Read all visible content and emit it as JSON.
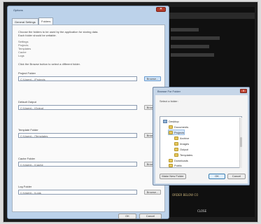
{
  "dark_app": {
    "status_1": "ORDER BELOW CO",
    "status_2": "CLOSE"
  },
  "main_dialog": {
    "title": "Options",
    "close_glyph": "✕",
    "tabs": [
      {
        "label": "General Settings"
      },
      {
        "label": "Folders"
      }
    ],
    "description": [
      "Choose the folders to be used by the application for storing data.",
      "Each folder should be writable."
    ],
    "list_items": [
      "Settings",
      "Projects",
      "Templates",
      "Cache",
      "Logs"
    ],
    "instruction": "Click the Browse button to select a different folder.",
    "fields": [
      {
        "label": "Project Folder",
        "value": "C:\\Users\\...\\Projects",
        "button": "Browse..."
      },
      {
        "label": "Default Output",
        "value": "C:\\Users\\...\\Output",
        "button": "Browse..."
      },
      {
        "label": "Template Folder",
        "value": "C:\\Users\\...\\Templates",
        "button": "Browse..."
      },
      {
        "label": "Cache Folder",
        "value": "C:\\Users\\...\\Cache",
        "button": "Browse..."
      },
      {
        "label": "Log Folder",
        "value": "C:\\Users\\...\\Logs",
        "button": "Browse..."
      }
    ],
    "ok_label": "OK",
    "cancel_label": "Cancel"
  },
  "folder_dialog": {
    "title": "Browse For Folder",
    "close_glyph": "✕",
    "prompt": "Select a folder:",
    "tree": [
      {
        "label": "Desktop",
        "icon": "pc-icon"
      },
      {
        "label": "Documents",
        "icon": "folder-icon"
      },
      {
        "label": "Projects",
        "icon": "folder-icon"
      },
      {
        "label": "Archive",
        "icon": "folder-icon"
      },
      {
        "label": "Images",
        "icon": "folder-icon"
      },
      {
        "label": "Output",
        "icon": "folder-icon"
      },
      {
        "label": "Templates",
        "icon": "folder-icon"
      },
      {
        "label": "Downloads",
        "icon": "folder-icon"
      },
      {
        "label": "Public",
        "icon": "folder-icon"
      }
    ],
    "new_folder_label": "Make New Folder",
    "ok_label": "OK",
    "cancel_label": "Cancel"
  }
}
